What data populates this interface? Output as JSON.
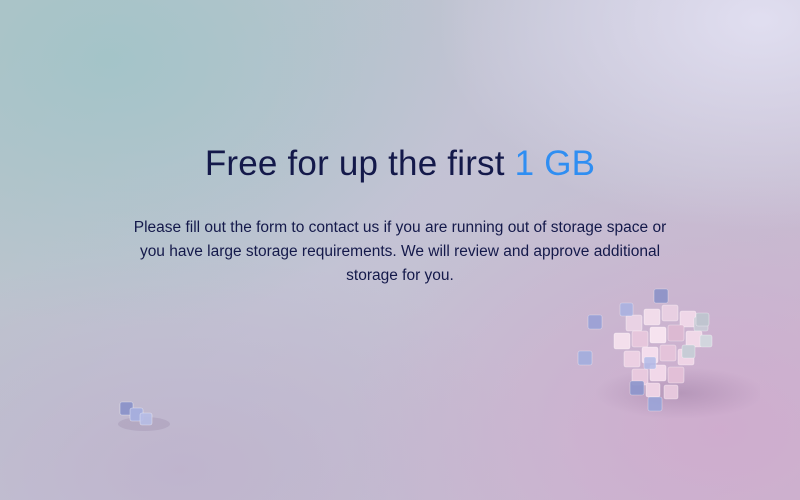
{
  "hero": {
    "title_prefix": "Free for up the first",
    "title_highlight": "1 GB",
    "description": "Please fill out the form to contact us if you are running out of storage space or you have large storage requirements. We will review and approve additional storage for you."
  },
  "decor": {
    "right_illustration_icon": "cube-cluster-icon",
    "left_illustration_icon": "small-cubes-icon"
  },
  "colors": {
    "heading": "#14194a",
    "accent": "#2f8ef2"
  }
}
